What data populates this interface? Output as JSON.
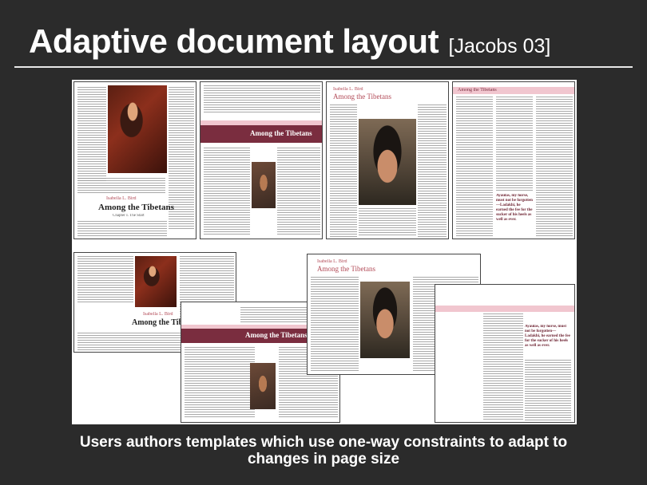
{
  "slide": {
    "title": "Adaptive document layout",
    "citation": "[Jacobs 03]",
    "caption_line1": "Users authors templates which use one-way constraints to adapt to",
    "caption_line2": "changes in page size"
  },
  "sample_pages": {
    "byline": "Isabella L. Bird",
    "headline": "Among the Tibetans",
    "chapter": "Chapter I. The Start",
    "running_head": "Among the Tibetans",
    "pullquote": "Ayaulas, my horse, must not be forgotten—Ladakhi, he earned the fee for the sucker of his heels as well as ever."
  },
  "colors": {
    "background": "#2b2b2b",
    "accent_band": "#7a2d3f",
    "accent_text": "#b24a57",
    "rule": "#e8e8e8"
  }
}
